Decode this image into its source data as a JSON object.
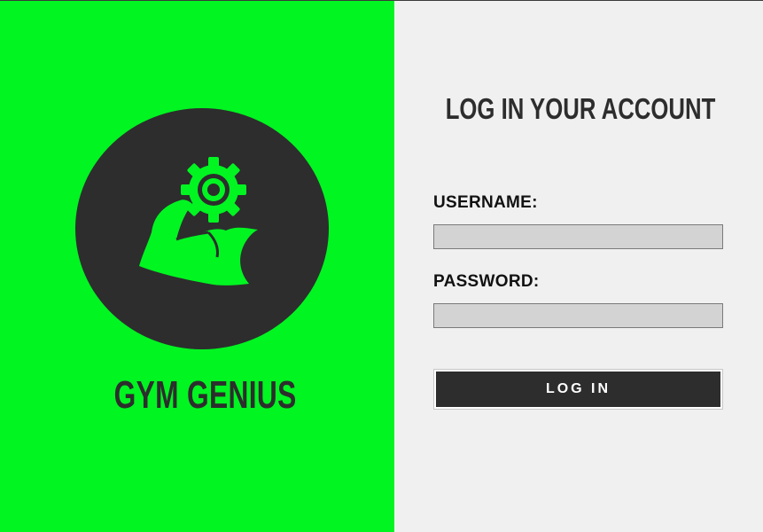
{
  "brand": {
    "name": "GYM GENIUS",
    "logo_icon": "flexed-arm-gear-icon",
    "accent_color": "#00f521",
    "dark_color": "#2d2d2d"
  },
  "login_form": {
    "title": "LOG IN YOUR ACCOUNT",
    "username_label": "USERNAME:",
    "username_value": "",
    "password_label": "PASSWORD:",
    "password_value": "",
    "submit_label": "LOG IN",
    "input_background": "#d3d3d3"
  }
}
